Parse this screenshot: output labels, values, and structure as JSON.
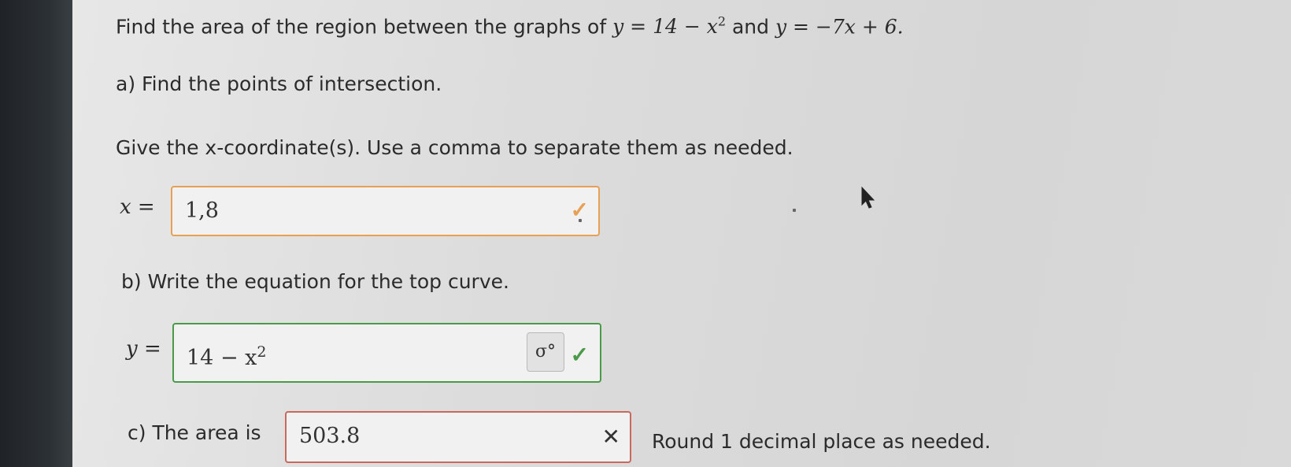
{
  "question": {
    "intro_text": "Find the area of the region between the graphs of",
    "eq1": "y = 14 − x",
    "eq1_exp": "2",
    "and_text": "and",
    "eq2": "y = −7x + 6."
  },
  "part_a": {
    "heading": "a) Find the points of intersection.",
    "instruction": "Give the x-coordinate(s). Use a comma to separate them as needed.",
    "var_label": "x =",
    "answer_value": "1,8",
    "status": "correct-attempt",
    "status_color": "#e6a157"
  },
  "part_b": {
    "heading": "b) Write the equation for the top curve.",
    "var_label": "y =",
    "answer_value": "14 − x",
    "answer_exp": "2",
    "status": "correct",
    "status_color": "#4a9a4a",
    "tool_button_glyph": "σ°"
  },
  "part_c": {
    "prefix": "c) The area is",
    "answer_value": "503.8",
    "status": "incorrect",
    "status_color": "#c9685c",
    "suffix": "Round 1 decimal place as needed."
  },
  "icons": {
    "check": "✓",
    "cross": "✕"
  }
}
